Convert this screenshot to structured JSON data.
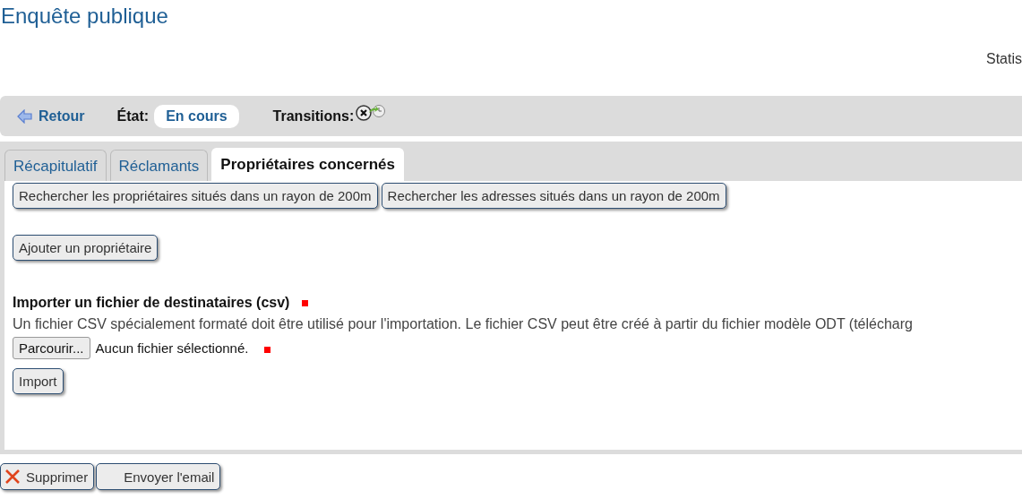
{
  "title": "Enquête publique",
  "stats_link": "Statis",
  "toolbar": {
    "back": "Retour",
    "state_label": "État:",
    "state_value": "En cours",
    "transitions_label": "Transitions:"
  },
  "tabs": [
    {
      "label": "Récapitulatif",
      "selected": false
    },
    {
      "label": "Réclamants",
      "selected": false
    },
    {
      "label": "Propriétaires concernés",
      "selected": true
    }
  ],
  "search_buttons": [
    "Rechercher les propriétaires situés dans un rayon de 200m",
    "Rechercher les adresses situés dans un rayon de 200m"
  ],
  "add_button": "Ajouter un propriétaire",
  "import": {
    "heading": "Importer un fichier de destinataires (csv)",
    "required": true,
    "description": "Un fichier CSV spécialement formaté doit être utilisé pour l'importation. Le fichier CSV peut être créé à partir du fichier modèle ODT (télécharg",
    "browse": "Parcourir...",
    "file_status": "Aucun fichier sélectionné.",
    "file_required": true,
    "submit": "Import"
  },
  "actions": [
    {
      "kind": "delete",
      "label": "Supprimer"
    },
    {
      "kind": "plain",
      "label": "Envoyer l'email"
    }
  ]
}
